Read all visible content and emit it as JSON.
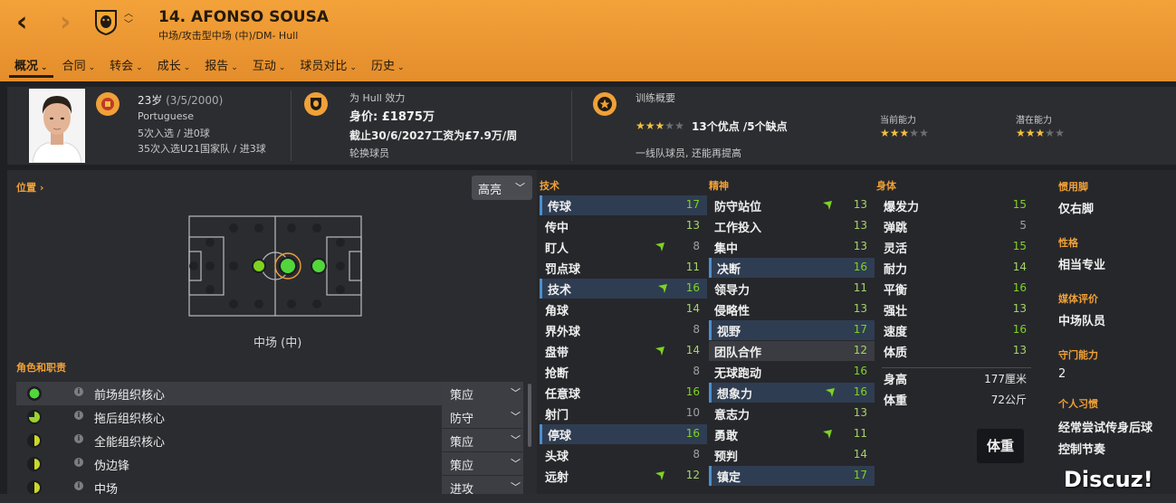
{
  "header": {
    "player_name": "14. AFONSO SOUSA",
    "player_sub": "中场/攻击型中场 (中)/DM- Hull",
    "tabs": [
      {
        "label": "概况",
        "active": true
      },
      {
        "label": "合同"
      },
      {
        "label": "转会"
      },
      {
        "label": "成长"
      },
      {
        "label": "报告"
      },
      {
        "label": "互动"
      },
      {
        "label": "球员对比"
      },
      {
        "label": "历史"
      }
    ]
  },
  "info": {
    "age_line_a": "23岁",
    "age_line_b": "(3/5/2000)",
    "nationality": "Portuguese",
    "caps_line": "5次入选 / 进0球",
    "u21_line": "35次入选U21国家队 / 进3球",
    "club_label": "为 Hull 效力",
    "value": "身价: £1875万",
    "contract": "截止30/6/2027工资为£7.9万/周",
    "squad_status": "轮换球员",
    "training_title": "训练概要",
    "training_summary": "13个优点 /5个缺点",
    "training_stars": 3,
    "training_note": "一线队球员, 还能再提高",
    "current_ability_label": "当前能力",
    "current_ability_stars": 3,
    "potential_ability_label": "潜在能力",
    "potential_ability_stars": 3
  },
  "positions": {
    "section_label": "位置 ›",
    "highlight_label": "高亮",
    "position_caption": "中场 (中)"
  },
  "roles": {
    "section_label": "角色和职责",
    "items": [
      {
        "name": "前场组织核心",
        "duty": "策应",
        "rating": "full",
        "selected": true
      },
      {
        "name": "拖后组织核心",
        "duty": "防守",
        "rating": "most"
      },
      {
        "name": "全能组织核心",
        "duty": "策应",
        "rating": "half"
      },
      {
        "name": "伪边锋",
        "duty": "策应",
        "rating": "half"
      },
      {
        "name": "中场",
        "duty": "进攻",
        "rating": "half"
      }
    ]
  },
  "technical": {
    "label": "技术",
    "rows": [
      {
        "name": "传球",
        "value": "17",
        "arrow": false,
        "hl": "blue"
      },
      {
        "name": "传中",
        "value": "13",
        "arrow": false
      },
      {
        "name": "盯人",
        "value": "8",
        "arrow": true
      },
      {
        "name": "罚点球",
        "value": "11",
        "arrow": false
      },
      {
        "name": "技术",
        "value": "16",
        "arrow": true,
        "hl": "blue"
      },
      {
        "name": "角球",
        "value": "14",
        "arrow": false
      },
      {
        "name": "界外球",
        "value": "8",
        "arrow": false
      },
      {
        "name": "盘带",
        "value": "14",
        "arrow": true
      },
      {
        "name": "抢断",
        "value": "8",
        "arrow": false
      },
      {
        "name": "任意球",
        "value": "16",
        "arrow": false
      },
      {
        "name": "射门",
        "value": "10",
        "arrow": false
      },
      {
        "name": "停球",
        "value": "16",
        "arrow": false,
        "hl": "blue"
      },
      {
        "name": "头球",
        "value": "8",
        "arrow": false
      },
      {
        "name": "远射",
        "value": "12",
        "arrow": true
      }
    ]
  },
  "mental": {
    "label": "精神",
    "rows": [
      {
        "name": "防守站位",
        "value": "13",
        "arrow": true
      },
      {
        "name": "工作投入",
        "value": "13",
        "arrow": false
      },
      {
        "name": "集中",
        "value": "13",
        "arrow": false
      },
      {
        "name": "决断",
        "value": "16",
        "arrow": false,
        "hl": "blue"
      },
      {
        "name": "领导力",
        "value": "11",
        "arrow": false
      },
      {
        "name": "侵略性",
        "value": "13",
        "arrow": false
      },
      {
        "name": "视野",
        "value": "17",
        "arrow": false,
        "hl": "blue"
      },
      {
        "name": "团队合作",
        "value": "12",
        "arrow": false,
        "hl": "grey"
      },
      {
        "name": "无球跑动",
        "value": "16",
        "arrow": false
      },
      {
        "name": "想象力",
        "value": "16",
        "arrow": true,
        "hl": "blue"
      },
      {
        "name": "意志力",
        "value": "13",
        "arrow": false
      },
      {
        "name": "勇敢",
        "value": "11",
        "arrow": true
      },
      {
        "name": "预判",
        "value": "14",
        "arrow": false
      },
      {
        "name": "镇定",
        "value": "17",
        "arrow": false,
        "hl": "blue"
      }
    ]
  },
  "physical": {
    "label": "身体",
    "rows": [
      {
        "name": "爆发力",
        "value": "15"
      },
      {
        "name": "弹跳",
        "value": "5"
      },
      {
        "name": "灵活",
        "value": "15"
      },
      {
        "name": "耐力",
        "value": "14"
      },
      {
        "name": "平衡",
        "value": "16"
      },
      {
        "name": "强壮",
        "value": "13"
      },
      {
        "name": "速度",
        "value": "16"
      },
      {
        "name": "体质",
        "value": "13"
      }
    ],
    "height_label": "身高",
    "height_value": "177厘米",
    "weight_label": "体重",
    "weight_value": "72公斤",
    "tooltip": "体重"
  },
  "side_info": {
    "foot_label": "惯用脚",
    "foot_value": "仅右脚",
    "personality_label": "性格",
    "personality_value": "相当专业",
    "media_label": "媒体评价",
    "media_value": "中场队员",
    "gk_label": "守门能力",
    "gk_value": "2",
    "habits_label": "个人习惯",
    "habit_1": "经常尝试传身后球",
    "habit_2": "控制节奏"
  },
  "watermark": "Discuz!",
  "colors": {
    "header_orange": "#ea9531",
    "accent_orange": "#f0a137",
    "good_green": "#7ed321",
    "highlight_blue": "#2f3d52"
  }
}
